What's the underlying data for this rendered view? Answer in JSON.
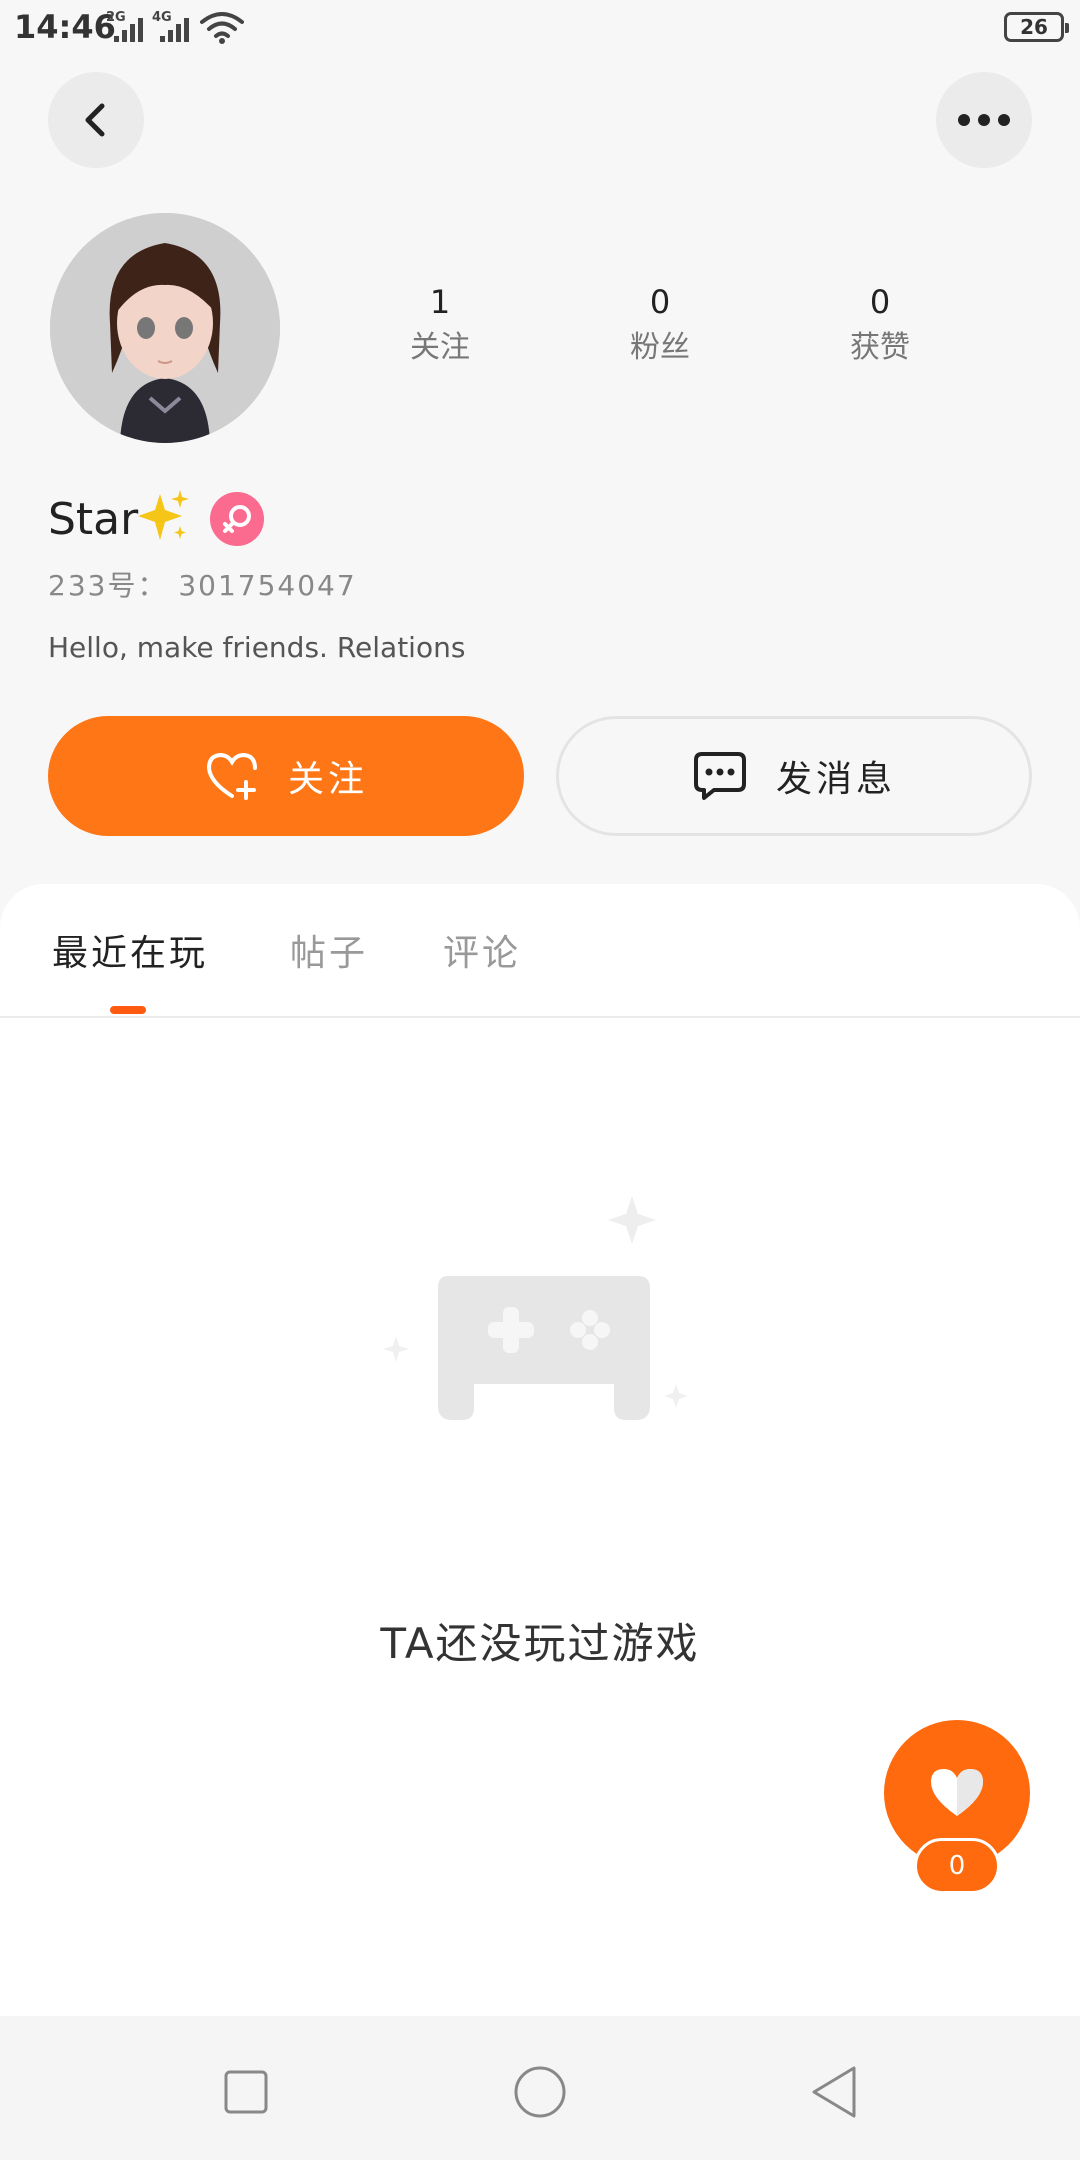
{
  "status_bar": {
    "time": "14:46",
    "network_1": "2G",
    "network_2": "4G",
    "battery_level": "26"
  },
  "header": {
    "back_icon": "chevron-left-icon",
    "more_icon": "more-dots-icon"
  },
  "profile": {
    "stats": [
      {
        "value": "1",
        "label": "关注"
      },
      {
        "value": "0",
        "label": "粉丝"
      },
      {
        "value": "0",
        "label": "获赞"
      }
    ],
    "username": "Star",
    "gender": "female",
    "user_id": "233号： 301754047",
    "bio": "Hello, make friends. Relations"
  },
  "actions": {
    "follow_label": "关注",
    "message_label": "发消息"
  },
  "tabs": [
    {
      "label": "最近在玩"
    },
    {
      "label": "帖子"
    },
    {
      "label": "评论"
    }
  ],
  "active_tab": 0,
  "empty_state": {
    "text": "TA还没玩过游戏"
  },
  "like_fab": {
    "count": "0"
  },
  "colors": {
    "accent": "#fe7616",
    "gender_badge": "#fb6a8f",
    "tab_indicator": "#fe5a12"
  }
}
